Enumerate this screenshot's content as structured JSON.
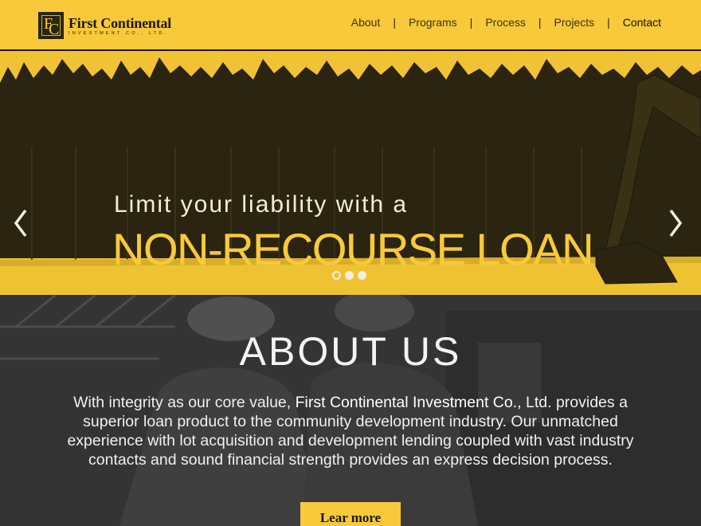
{
  "brand": {
    "logo_initial_1": "F",
    "logo_initial_2": "C",
    "name": "First Continental",
    "subtitle": "INVESTMENT CO., LTD."
  },
  "nav": {
    "items": [
      {
        "label": "About"
      },
      {
        "label": "Programs"
      },
      {
        "label": "Process"
      },
      {
        "label": "Projects"
      },
      {
        "label": "Contact"
      }
    ],
    "separator": "|"
  },
  "hero": {
    "line1": "Limit your liability with a",
    "line2": "NON-RECOURSE LOAN",
    "slide_count": 3,
    "active_slide": 1,
    "prev_icon": "chevron-left-icon",
    "next_icon": "chevron-right-icon"
  },
  "about": {
    "title": "ABOUT US",
    "text_before": "With integrity as our core value, ",
    "company": "First Continental Investment Co.",
    "text_after": ", Ltd. provides a superior loan product to the community development industry. Our unmatched experience with lot acquisition and development lending coupled with vast industry contacts and sound financial strength provides an express decision process.",
    "cta_label": "Lear more"
  },
  "colors": {
    "brand_yellow": "#f8c93a",
    "dark": "#1c1808",
    "hero_shadow": "#2a2410"
  }
}
